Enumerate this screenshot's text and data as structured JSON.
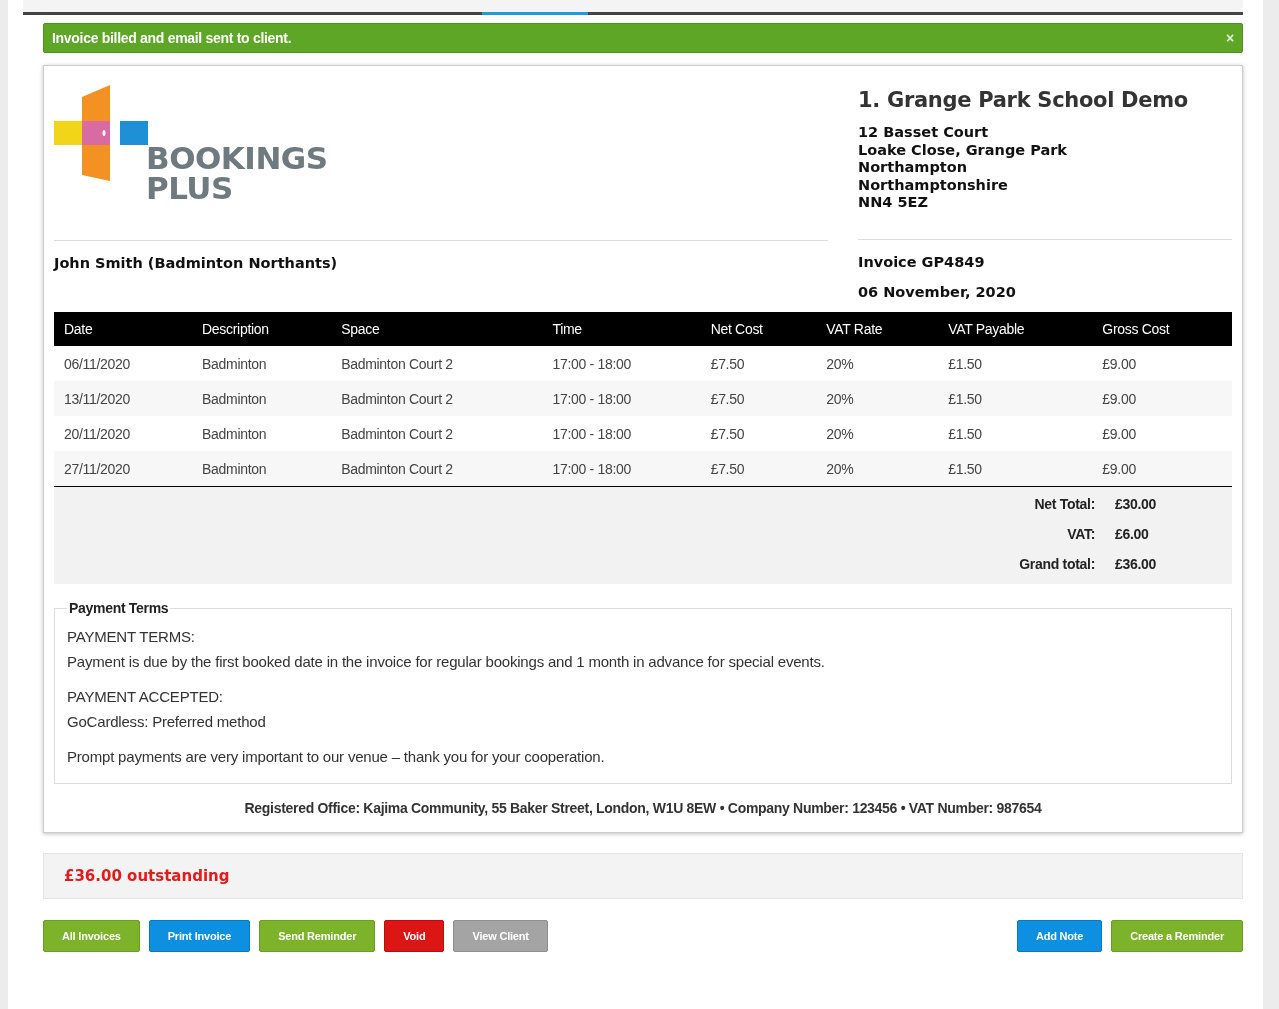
{
  "alert": {
    "message": "Invoice billed and email sent to client.",
    "close": "×"
  },
  "logo": {
    "line_1": "BOOKINGS",
    "line_2": "PLUS"
  },
  "venue": {
    "name": "1. Grange Park School Demo",
    "address": [
      "12 Basset Court",
      "Loake Close, Grange Park",
      "Northampton",
      "Northamptonshire",
      "NN4 5EZ"
    ]
  },
  "client": "John Smith (Badminton Northants)",
  "invoice": {
    "number": "Invoice GP4849",
    "date": "06 November, 2020"
  },
  "table": {
    "columns": [
      "Date",
      "Description",
      "Space",
      "Time",
      "Net Cost",
      "VAT Rate",
      "VAT Payable",
      "Gross Cost"
    ],
    "rows": [
      [
        "06/11/2020",
        "Badminton",
        "Badminton Court 2",
        "17:00 - 18:00",
        "£7.50",
        "20%",
        "£1.50",
        "£9.00"
      ],
      [
        "13/11/2020",
        "Badminton",
        "Badminton Court 2",
        "17:00 - 18:00",
        "£7.50",
        "20%",
        "£1.50",
        "£9.00"
      ],
      [
        "20/11/2020",
        "Badminton",
        "Badminton Court 2",
        "17:00 - 18:00",
        "£7.50",
        "20%",
        "£1.50",
        "£9.00"
      ],
      [
        "27/11/2020",
        "Badminton",
        "Badminton Court 2",
        "17:00 - 18:00",
        "£7.50",
        "20%",
        "£1.50",
        "£9.00"
      ]
    ],
    "totals": [
      {
        "label": "Net Total:",
        "value": "£30.00"
      },
      {
        "label": "VAT:",
        "value": "£6.00"
      },
      {
        "label": "Grand total:",
        "value": "£36.00"
      }
    ]
  },
  "payment_terms": {
    "title": "Payment Terms",
    "paragraphs": [
      [
        "PAYMENT TERMS:",
        "Payment is due by the first booked date in the invoice for regular bookings and 1 month in advance for special events."
      ],
      [
        "PAYMENT ACCEPTED:",
        "GoCardless: Preferred method"
      ],
      [
        "Prompt payments are very important to our venue – thank you for your cooperation."
      ]
    ]
  },
  "footer": "Registered Office: Kajima Community, 55 Baker Street, London, W1U 8EW • Company Number: 123456 • VAT Number: 987654",
  "outstanding": "£36.00 outstanding",
  "buttons_left": [
    {
      "label": "All Invoices",
      "kind": "green"
    },
    {
      "label": "Print Invoice",
      "kind": "blue"
    },
    {
      "label": "Send Reminder",
      "kind": "green"
    },
    {
      "label": "Void",
      "kind": "red"
    },
    {
      "label": "View Client",
      "kind": "grey"
    }
  ],
  "buttons_right": [
    {
      "label": "Add Note",
      "kind": "blue"
    },
    {
      "label": "Create a Reminder",
      "kind": "green"
    }
  ]
}
